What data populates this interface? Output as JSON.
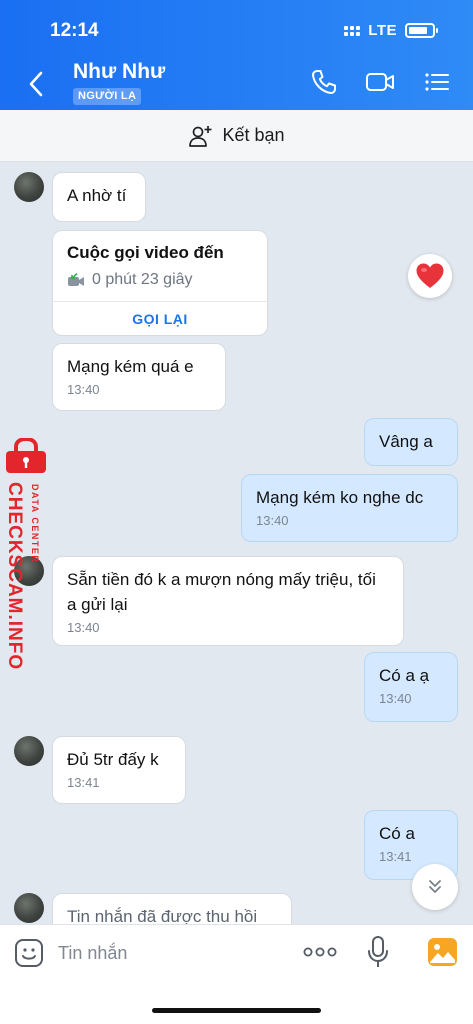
{
  "status_bar": {
    "time": "12:14",
    "network": "LTE"
  },
  "header": {
    "contact_name": "Như Như",
    "badge": "NGƯỜI LẠ",
    "icons": [
      "back-icon",
      "phone-icon",
      "video-call-icon",
      "menu-icon"
    ]
  },
  "add_friend": {
    "label": "Kết bạn",
    "icon": "add-user-icon"
  },
  "call_card": {
    "title": "Cuộc gọi video đến",
    "duration": "0 phút 23 giây",
    "callback_label": "GỌI LẠI"
  },
  "messages": [
    {
      "from": "them",
      "text": "A nhờ tí",
      "time": ""
    },
    {
      "from": "them",
      "text": "Mạng kém quá e",
      "time": "13:40"
    },
    {
      "from": "me",
      "text": "Vâng a",
      "time": ""
    },
    {
      "from": "me",
      "text": "Mạng kém ko nghe dc",
      "time": "13:40"
    },
    {
      "from": "them",
      "text": "Sẵn tiền đó k a mượn nóng mấy triệu, tối a gửi lại",
      "time": "13:40"
    },
    {
      "from": "me",
      "text": "Có a ạ",
      "time": "13:40"
    },
    {
      "from": "them",
      "text": "Đủ 5tr đấy k",
      "time": "13:41"
    },
    {
      "from": "me",
      "text": "Có a",
      "time": "13:41"
    },
    {
      "from": "them",
      "text": "Tin nhắn đã được thu hồi",
      "time": ""
    }
  ],
  "reaction": {
    "icon": "heart-icon",
    "color": "#e8333b"
  },
  "watermark": {
    "text": "CHECKSCAM.INFO",
    "sub": "DATA CENTER"
  },
  "input": {
    "placeholder": "Tin nhắn"
  },
  "colors": {
    "header": "#1a6ff2",
    "chat_bg": "#e2e8ef",
    "my_bubble": "#d4e9ff",
    "accent": "#1b74e8",
    "watermark": "#e3262c"
  }
}
